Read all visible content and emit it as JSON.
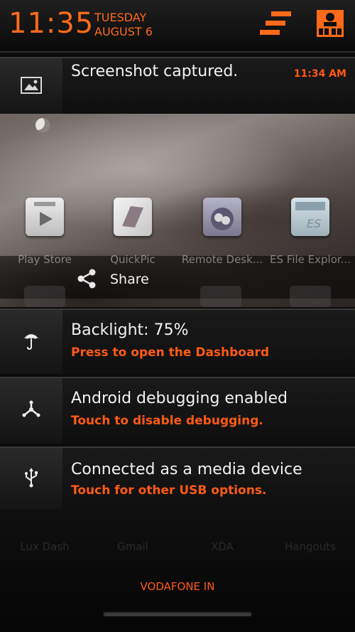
{
  "status": {
    "time": "11:35",
    "day": "TUESDAY",
    "date": "AUGUST 6"
  },
  "header_icons": {
    "settings": "quick-settings-icon",
    "user": "user-profile-icon"
  },
  "notifications": [
    {
      "title": "Screenshot captured.",
      "time": "11:34 AM",
      "icon": "image-icon"
    },
    {
      "title": "Backlight: 75%",
      "subtitle": "Press to open the Dashboard",
      "icon": "umbrella-icon"
    },
    {
      "title": "Android debugging enabled",
      "subtitle": "Touch to disable debugging.",
      "icon": "debug-icon"
    },
    {
      "title": "Connected as a media device",
      "subtitle": "Touch for other USB options.",
      "icon": "usb-icon"
    }
  ],
  "screenshot_preview": {
    "apps": [
      "Play Store",
      "QuickPic",
      "Remote Desk...",
      "ES File Explor..."
    ],
    "share_label": "Share"
  },
  "dock": {
    "apps": [
      "Lux Dash",
      "Gmail",
      "XDA",
      "Hangouts"
    ]
  },
  "carrier": "VODAFONE IN",
  "colors": {
    "accent": "#ff5a14",
    "background": "#0b0b0b"
  }
}
